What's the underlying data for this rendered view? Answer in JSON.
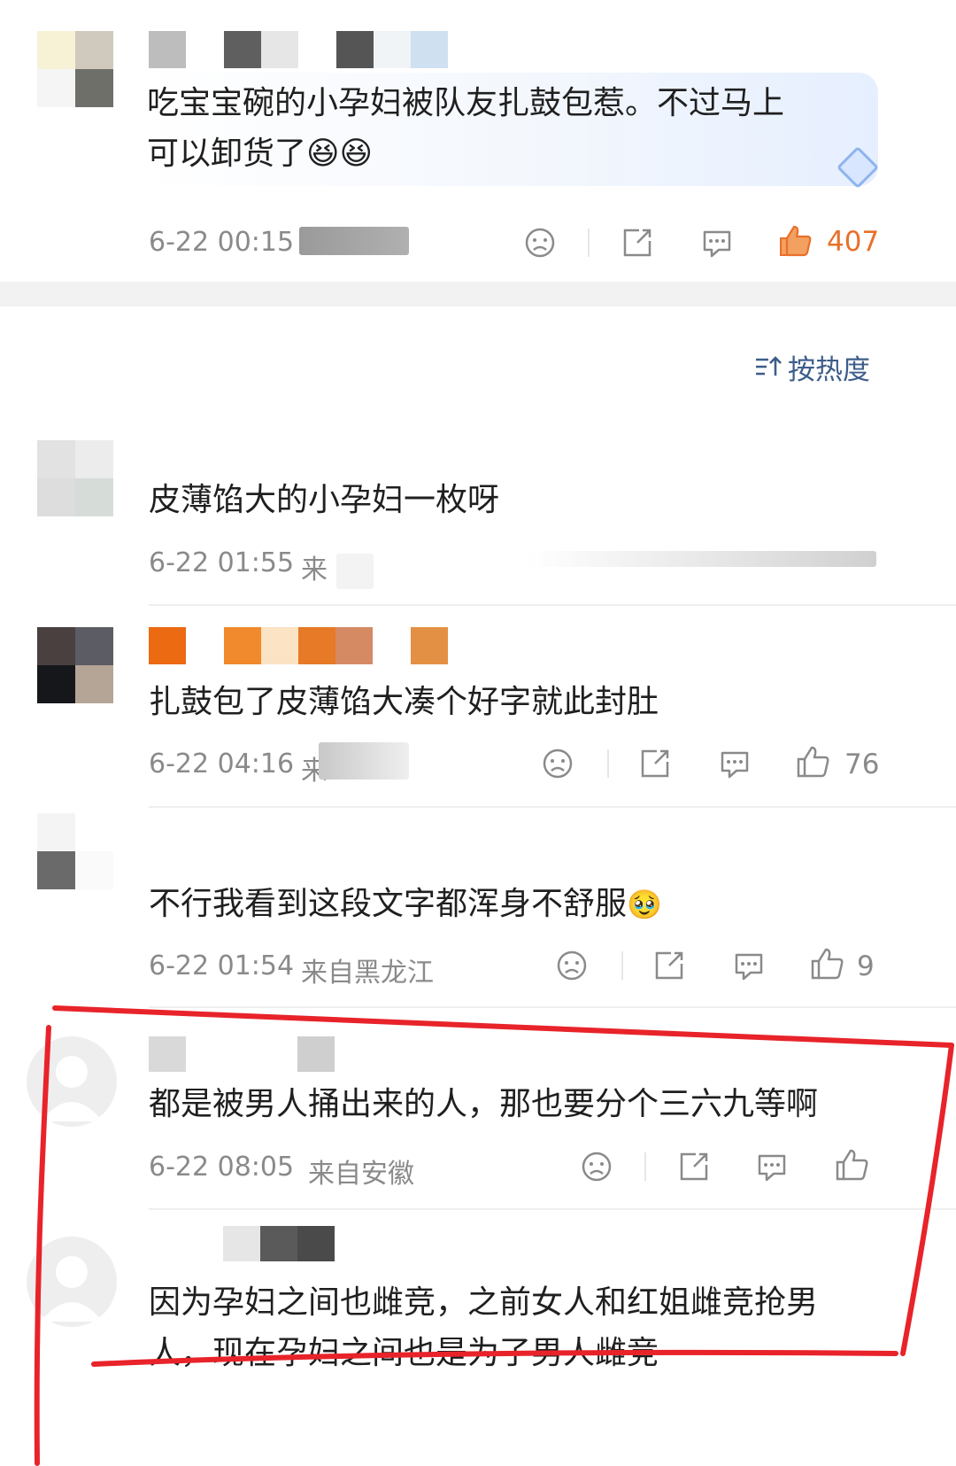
{
  "top_comment": {
    "text_line1": "吃宝宝碗的小孕妇被队友扎鼓包惹。不过马上",
    "text_line2": "可以卸货了",
    "emoji": "😆😆",
    "time": "6-22 00:15",
    "like_count": "407"
  },
  "sort": {
    "icon": "sort-icon",
    "label": "按热度"
  },
  "comments": [
    {
      "text": "皮薄馅大的小孕妇一枚呀",
      "time": "6-22 01:55",
      "location": "来"
    },
    {
      "text": "扎鼓包了皮薄馅大凑个好字就此封肚",
      "time": "6-22 04:16",
      "location": "来",
      "like_count": "76"
    },
    {
      "text": "不行我看到这段文字都浑身不舒服",
      "emoji": "🥹",
      "time": "6-22 01:54",
      "location": "来自黑龙江",
      "like_count": "9"
    },
    {
      "text": "都是被男人捅出来的人，那也要分个三六九等啊",
      "time": "6-22 08:05",
      "location": "来自安徽"
    },
    {
      "text_line1": "因为孕妇之间也雌竞，之前女人和红姐雌竞抢男",
      "text_line2": "人，现在孕妇之间也是为了男人雌竞"
    }
  ],
  "colors": {
    "accent_like": "#e8702a",
    "annotation_red": "#e8232a",
    "sort_blue": "#3d5d8a",
    "meta_gray": "#8a8a8a"
  }
}
